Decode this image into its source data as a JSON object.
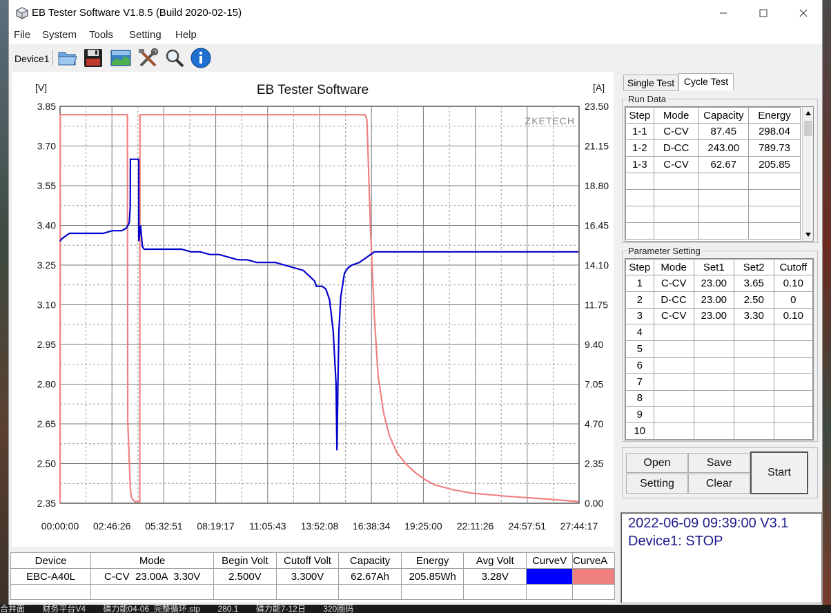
{
  "window": {
    "title": "EB Tester Software V1.8.5 (Build 2020-02-15)"
  },
  "menu": [
    "File",
    "System",
    "Tools",
    "Setting",
    "Help"
  ],
  "toolbar": {
    "device_tab": "Device1",
    "buttons": [
      "folder-open-icon",
      "save-disk-icon",
      "chart-image-icon",
      "tools-wrench-icon",
      "magnifier-icon",
      "info-icon"
    ]
  },
  "chart_data": {
    "type": "line",
    "title": "EB Tester Software",
    "watermark": "ZKETECH",
    "ylabel_left": "[V]",
    "ylabel_right": "[A]",
    "y_left_ticks": [
      "3.85",
      "3.70",
      "3.55",
      "3.40",
      "3.25",
      "3.10",
      "2.95",
      "2.80",
      "2.65",
      "2.50",
      "2.35"
    ],
    "y_right_ticks": [
      "23.50",
      "21.15",
      "18.80",
      "16.45",
      "14.10",
      "11.75",
      "9.40",
      "7.05",
      "4.70",
      "2.35",
      "0.00"
    ],
    "x_ticks": [
      "00:00:00",
      "02:46:26",
      "05:32:51",
      "08:19:17",
      "11:05:43",
      "13:52:08",
      "16:38:34",
      "19:25:00",
      "22:11:26",
      "24:57:51",
      "27:44:17"
    ],
    "ylim_left": [
      2.35,
      3.85
    ],
    "ylim_right": [
      0,
      23.5
    ],
    "xlim_hours": [
      0,
      27.738
    ],
    "grid": true,
    "series": [
      {
        "name": "CurveV",
        "axis": "left",
        "color": "#0000cc",
        "x": [
          0,
          0.1,
          0.5,
          1.0,
          2.0,
          2.3,
          2.8,
          3.3,
          3.55,
          3.7,
          3.75,
          3.76,
          4.2,
          4.21,
          4.3,
          4.4,
          4.5,
          5.0,
          6.5,
          7.0,
          7.5,
          8.0,
          8.5,
          9.0,
          9.5,
          10.0,
          10.5,
          11.0,
          11.5,
          12.0,
          12.5,
          13.0,
          13.3,
          13.6,
          13.7,
          14.0,
          14.2,
          14.4,
          14.6,
          14.75,
          14.8,
          14.85,
          14.9,
          15.0,
          15.2,
          15.4,
          15.6,
          16.0,
          16.4,
          16.6,
          16.8,
          17.0,
          20,
          24,
          27.7
        ],
        "values": [
          3.34,
          3.35,
          3.37,
          3.37,
          3.37,
          3.37,
          3.38,
          3.38,
          3.39,
          3.41,
          3.47,
          3.65,
          3.65,
          3.34,
          3.4,
          3.32,
          3.31,
          3.31,
          3.31,
          3.3,
          3.3,
          3.29,
          3.29,
          3.28,
          3.27,
          3.27,
          3.26,
          3.26,
          3.26,
          3.25,
          3.24,
          3.23,
          3.21,
          3.19,
          3.17,
          3.17,
          3.16,
          3.12,
          3.0,
          2.8,
          2.55,
          2.8,
          3.0,
          3.13,
          3.22,
          3.24,
          3.25,
          3.26,
          3.28,
          3.29,
          3.3,
          3.3,
          3.3,
          3.3,
          3.3
        ]
      },
      {
        "name": "CurveA",
        "axis": "right",
        "color": "#f08080",
        "x": [
          0,
          0.01,
          3.6,
          3.62,
          3.75,
          3.8,
          3.9,
          4.0,
          4.25,
          4.26,
          4.27,
          16.3,
          16.4,
          16.45,
          16.6,
          16.8,
          17.0,
          17.3,
          17.6,
          18.0,
          18.5,
          19.0,
          19.5,
          20.0,
          21.0,
          22.0,
          24.0,
          26.0,
          27.7
        ],
        "values": [
          0,
          23.0,
          23.0,
          4.9,
          1.0,
          0.4,
          0.2,
          0.1,
          0.1,
          0.1,
          23.0,
          23.0,
          22.7,
          21.0,
          16.0,
          11.0,
          7.5,
          5.3,
          4.0,
          3.0,
          2.3,
          1.8,
          1.4,
          1.1,
          0.8,
          0.6,
          0.4,
          0.25,
          0.1
        ]
      }
    ]
  },
  "bottom_table": {
    "headers": [
      "Device",
      "Mode",
      "Begin Volt",
      "Cutoff Volt",
      "Capacity",
      "Energy",
      "Avg Volt",
      "CurveV",
      "CurveA"
    ],
    "row": [
      "EBC-A40L",
      "C-CV  23.00A  3.30V",
      "2.500V",
      "3.300V",
      "62.67Ah",
      "205.85Wh",
      "3.28V"
    ],
    "curve_colors": [
      "#0000ff",
      "#f08080"
    ]
  },
  "tabs": [
    "Single Test",
    "Cycle Test"
  ],
  "run_data": {
    "legend": "Run Data",
    "headers": [
      "Step",
      "Mode",
      "Capacity",
      "Energy"
    ],
    "rows": [
      [
        "1-1",
        "C-CV",
        "87.45",
        "298.04"
      ],
      [
        "1-2",
        "D-CC",
        "243.00",
        "789.73"
      ],
      [
        "1-3",
        "C-CV",
        "62.67",
        "205.85"
      ]
    ]
  },
  "param_setting": {
    "legend": "Parameter Setting",
    "headers": [
      "Step",
      "Mode",
      "Set1",
      "Set2",
      "Cutoff"
    ],
    "rows": [
      [
        "1",
        "C-CV",
        "23.00",
        "3.65",
        "0.10"
      ],
      [
        "2",
        "D-CC",
        "23.00",
        "2.50",
        "0"
      ],
      [
        "3",
        "C-CV",
        "23.00",
        "3.30",
        "0.10"
      ],
      [
        "4",
        "",
        "",
        "",
        ""
      ],
      [
        "5",
        "",
        "",
        "",
        ""
      ],
      [
        "6",
        "",
        "",
        "",
        ""
      ],
      [
        "7",
        "",
        "",
        "",
        ""
      ],
      [
        "8",
        "",
        "",
        "",
        ""
      ],
      [
        "9",
        "",
        "",
        "",
        ""
      ],
      [
        "10",
        "",
        "",
        "",
        ""
      ]
    ]
  },
  "buttons": {
    "open": "Open",
    "save": "Save",
    "setting": "Setting",
    "clear": "Clear",
    "start": "Start"
  },
  "status": {
    "line1": "2022-06-09 09:39:00  V3.1",
    "line2": "Device1: STOP"
  },
  "taskbar": {
    "items": [
      "合并面",
      "财务平台V4",
      "磷力能04-06_完整循环.stp",
      "280.1",
      "磷力能7-12日",
      "320圈码"
    ]
  }
}
